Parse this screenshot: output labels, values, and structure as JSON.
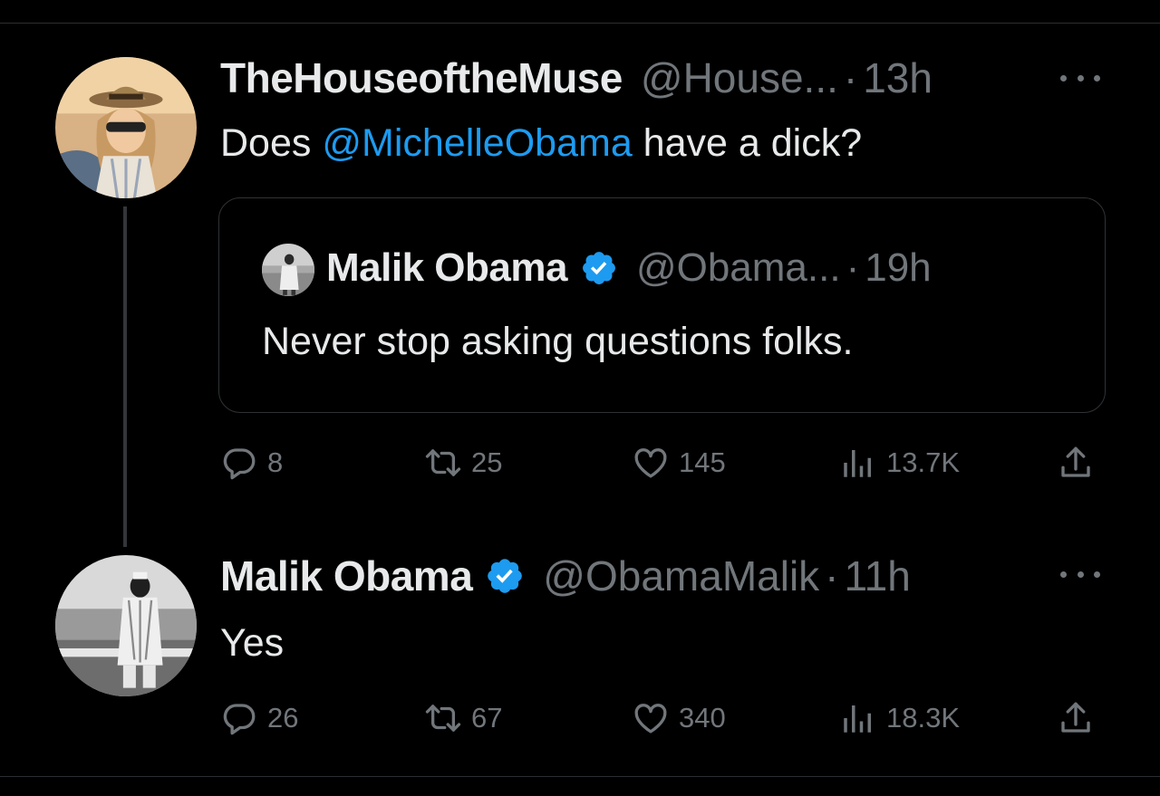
{
  "tweet": {
    "author_name": "TheHouseoftheMuse",
    "author_handle": "@House...",
    "separator": "·",
    "time": "13h",
    "text_prefix": "Does ",
    "mention": "@MichelleObama",
    "text_suffix": " have a dick?",
    "quoted": {
      "author_name": "Malik Obama",
      "author_handle": "@Obama...",
      "time": "19h",
      "text": "Never stop asking questions folks."
    },
    "stats": {
      "replies": "8",
      "retweets": "25",
      "likes": "145",
      "views": "13.7K"
    }
  },
  "reply": {
    "author_name": "Malik Obama",
    "author_handle": "@ObamaMalik",
    "separator": "·",
    "time": "11h",
    "text": "Yes",
    "stats": {
      "replies": "26",
      "retweets": "67",
      "likes": "340",
      "views": "18.3K"
    }
  },
  "icons": {
    "more": "more-icon",
    "verified": "verified-badge-icon",
    "reply": "reply-icon",
    "retweet": "retweet-icon",
    "like": "like-icon",
    "views": "views-icon",
    "share": "share-icon"
  },
  "colors": {
    "background": "#000000",
    "text": "#e7e9ea",
    "secondary": "#71767b",
    "accent": "#1d9bf0"
  }
}
